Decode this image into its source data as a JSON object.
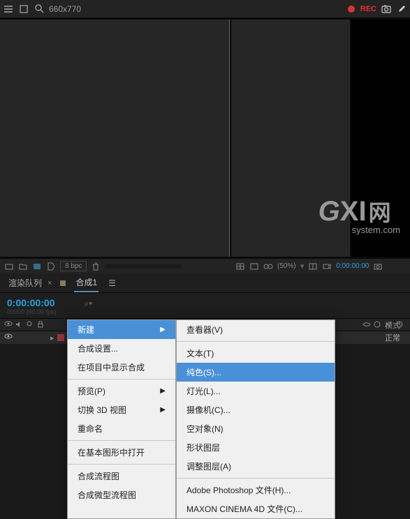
{
  "topbar": {
    "dimensions": "660x770",
    "rec_label": "REC"
  },
  "footer": {
    "bpc": "8 bpc",
    "zoom": "(50%)",
    "timecode": "0:00:00:00"
  },
  "tabs": {
    "render_queue": "渲染队列",
    "comp": "合成1",
    "menu": "☰"
  },
  "timeline": {
    "current_time": "0:00:00:00",
    "frame_info": "00000 (60.00 fps)",
    "search_placeholder": "⌕▾",
    "mode_header": "模式",
    "normal": "正常"
  },
  "watermark": {
    "g": "G",
    "xi": "XI",
    "cn": "网",
    "sub": "system.com"
  },
  "context_menu_left": {
    "new": "新建",
    "comp_settings": "合成设置...",
    "reveal_in_project": "在项目中显示合成",
    "preview": "预览(P)",
    "switch_3d": "切换 3D 视图",
    "rename": "重命名",
    "open_in_essential": "在基本图形中打开",
    "flowchart": "合成流程图",
    "mini_flowchart": "合成微型流程图"
  },
  "context_menu_right": {
    "viewer": "查看器(V)",
    "text": "文本(T)",
    "solid": "纯色(S)...",
    "light": "灯光(L)...",
    "camera": "摄像机(C)...",
    "null_obj": "空对象(N)",
    "shape": "形状图层",
    "adjustment": "调整图层(A)",
    "photoshop": "Adobe Photoshop 文件(H)...",
    "c4d": "MAXON CINEMA 4D 文件(C)..."
  }
}
